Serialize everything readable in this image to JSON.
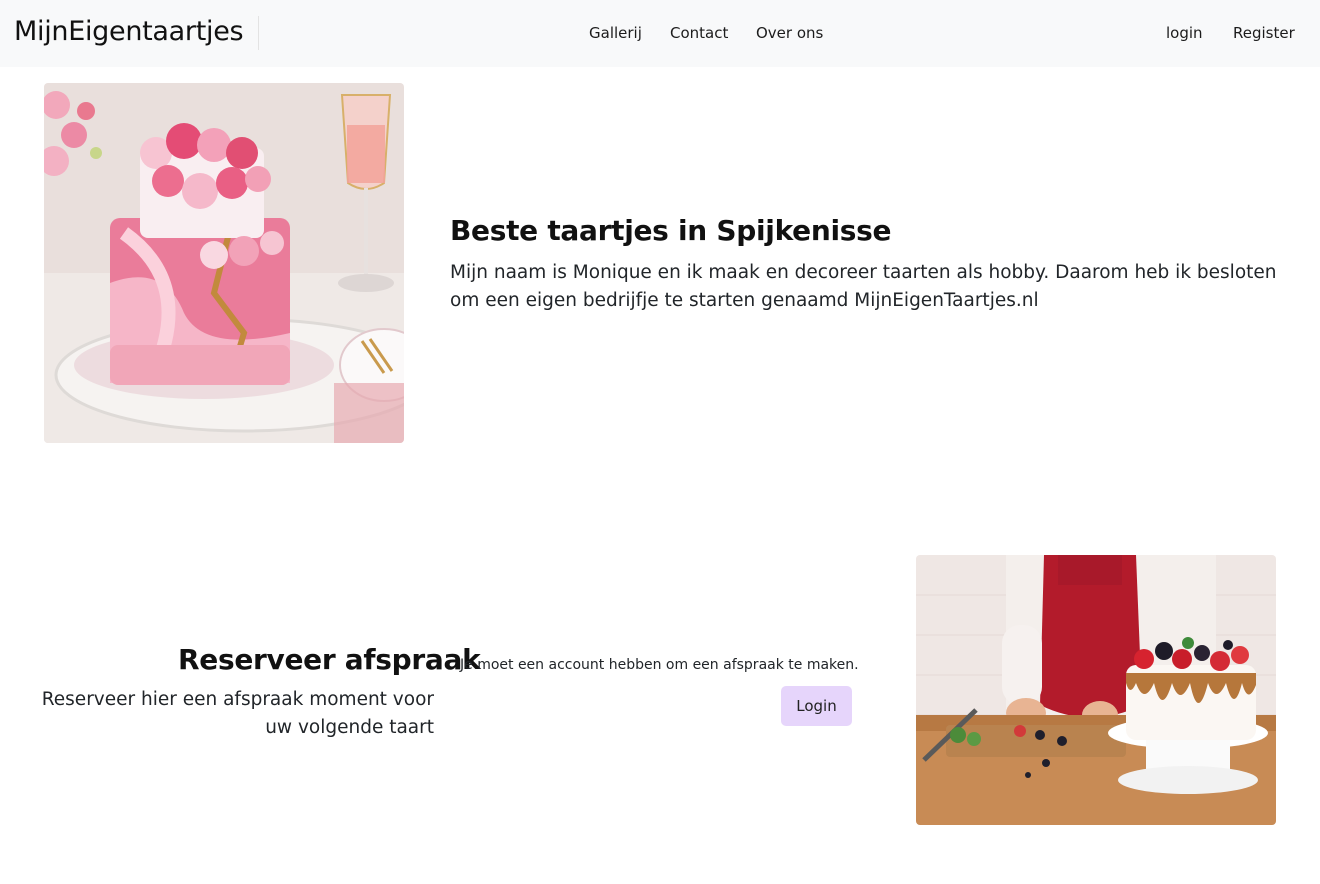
{
  "navbar": {
    "brand": "MijnEigentaartjes",
    "links": [
      "Gallerij",
      "Contact",
      "Over ons"
    ],
    "auth": {
      "login": "login",
      "register": "Register"
    }
  },
  "hero": {
    "image_icon": "pink-rose-cake-photo",
    "title": "Beste taartjes in Spijkenisse",
    "text": "Mijn naam is Monique en ik maak en decoreer taarten als hobby. Daarom heb ik besloten om een eigen bedrijfje te starten genaamd MijnEigenTaartjes.nl"
  },
  "reserve": {
    "title": "Reserveer afspraak",
    "text": "Reserveer hier een afspraak moment voor uw volgende taart",
    "notice": "Je moet een account hebben om een afspraak te maken.",
    "login_button": "Login",
    "image_icon": "baker-decorating-cake-photo"
  }
}
